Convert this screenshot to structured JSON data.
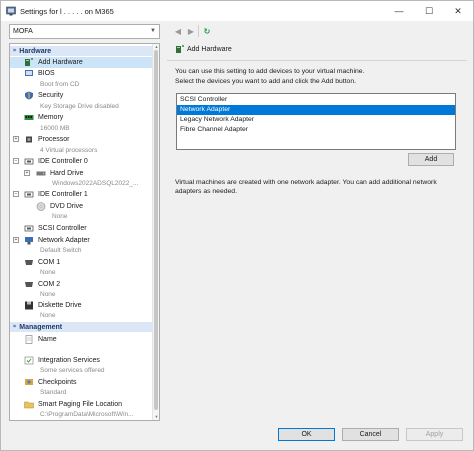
{
  "window": {
    "title": "Settings for l . . . . . on M365",
    "minimize_glyph": "—",
    "maximize_glyph": "☐",
    "close_glyph": "✕"
  },
  "toolbar": {
    "vm_selected": "MOFA",
    "back_glyph": "◀",
    "forward_glyph": "▶",
    "refresh_glyph": "↻"
  },
  "sidebar": {
    "hardware_header": "Hardware",
    "management_header": "Management",
    "items": [
      {
        "label": "Add Hardware",
        "sub": ""
      },
      {
        "label": "BIOS",
        "sub": "Boot from CD"
      },
      {
        "label": "Security",
        "sub": "Key Storage Drive disabled"
      },
      {
        "label": "Memory",
        "sub": "16000 MB"
      },
      {
        "label": "Processor",
        "sub": "4 Virtual processors"
      },
      {
        "label": "IDE Controller 0",
        "sub": ""
      },
      {
        "label": "Hard Drive",
        "sub": "Windows2022ADSQL2022_..."
      },
      {
        "label": "IDE Controller 1",
        "sub": ""
      },
      {
        "label": "DVD Drive",
        "sub": "None"
      },
      {
        "label": "SCSI Controller",
        "sub": ""
      },
      {
        "label": "Network Adapter",
        "sub": "Default Switch"
      },
      {
        "label": "COM 1",
        "sub": "None"
      },
      {
        "label": "COM 2",
        "sub": "None"
      },
      {
        "label": "Diskette Drive",
        "sub": "None"
      }
    ],
    "mgmt_items": [
      {
        "label": "Name",
        "sub": ""
      },
      {
        "label": "Integration Services",
        "sub": "Some services offered"
      },
      {
        "label": "Checkpoints",
        "sub": "Standard"
      },
      {
        "label": "Smart Paging File Location",
        "sub": "C:\\ProgramData\\Microsoft\\Win..."
      }
    ]
  },
  "panel": {
    "heading": "Add Hardware",
    "intro1": "You can use this setting to add devices to your virtual machine.",
    "intro2": "Select the devices you want to add and click the Add button.",
    "devices": [
      "SCSI Controller",
      "Network Adapter",
      "Legacy Network Adapter",
      "Fibre Channel Adapter"
    ],
    "selected_device": "Network Adapter",
    "add_label": "Add",
    "note1": "Virtual machines are created with one network adapter. You can add additional network",
    "note2": "adapters as needed."
  },
  "footer": {
    "ok_label": "OK",
    "cancel_label": "Cancel",
    "apply_label": "Apply"
  },
  "colors": {
    "accent": "#0078d7",
    "section_bg": "#dbe7f6",
    "selection_bg": "#cce4f7"
  }
}
